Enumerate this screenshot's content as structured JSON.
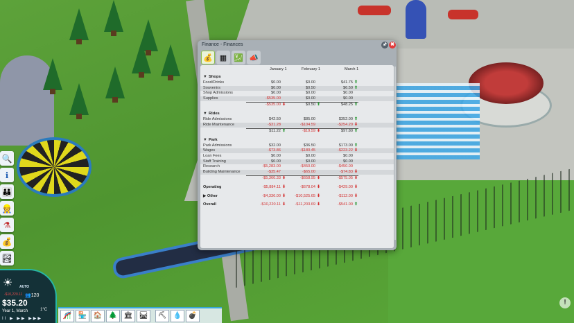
{
  "window": {
    "title": "Finance - Finances",
    "pin_glyph": "🖈",
    "close_glyph": "✖",
    "tabs": [
      {
        "icon": "coins-icon",
        "glyph": "💰",
        "active": true
      },
      {
        "icon": "safe-icon",
        "glyph": "▦",
        "active": false
      },
      {
        "icon": "money-chart-icon",
        "glyph": "💹",
        "active": false
      },
      {
        "icon": "marketing-icon",
        "glyph": "📣",
        "active": false
      }
    ]
  },
  "finance": {
    "months": [
      "January 1",
      "February 1",
      "March 1"
    ],
    "sections": [
      {
        "name": "Shops",
        "rows": [
          {
            "label": "Food/Drinks",
            "values": [
              "$0.00",
              "$0.00",
              "$41.75"
            ],
            "arrows": [
              "",
              "",
              "up"
            ]
          },
          {
            "label": "Souvenirs",
            "values": [
              "$0.00",
              "$0.50",
              "$6.50"
            ],
            "arrows": [
              "",
              "",
              "up"
            ]
          },
          {
            "label": "Shop Admissions",
            "values": [
              "$0.00",
              "$0.00",
              "$0.00"
            ],
            "arrows": [
              "",
              "",
              ""
            ]
          },
          {
            "label": "Supplies",
            "values": [
              "-$535.00",
              "$0.00",
              "$0.00"
            ],
            "arrows": [
              "",
              "",
              ""
            ]
          }
        ],
        "total": {
          "values": [
            "-$535.00",
            "$0.50",
            "$48.25"
          ],
          "arrows": [
            "down",
            "up",
            "up"
          ]
        }
      },
      {
        "name": "Rides",
        "rows": [
          {
            "label": "Ride Admissions",
            "values": [
              "$42.50",
              "$85.00",
              "$352.00"
            ],
            "arrows": [
              "",
              "",
              "up"
            ]
          },
          {
            "label": "Ride Maintenance",
            "values": [
              "-$31.28",
              "-$104.59",
              "-$254.20"
            ],
            "arrows": [
              "",
              "",
              "down"
            ]
          }
        ],
        "total": {
          "values": [
            "$11.22",
            "-$19.59",
            "$97.80"
          ],
          "arrows": [
            "up",
            "down",
            "up"
          ]
        }
      },
      {
        "name": "Park",
        "rows": [
          {
            "label": "Park Admissions",
            "values": [
              "$32.00",
              "$36.50",
              "$173.00"
            ],
            "arrows": [
              "",
              "",
              "up"
            ]
          },
          {
            "label": "Wages",
            "values": [
              "-$73.86",
              "-$180.45",
              "-$223.22"
            ],
            "arrows": [
              "",
              "",
              "down"
            ]
          },
          {
            "label": "Loan Fees",
            "values": [
              "$0.00",
              "$0.00",
              "$0.00"
            ],
            "arrows": [
              "",
              "",
              ""
            ]
          },
          {
            "label": "Staff Training",
            "values": [
              "$0.00",
              "$0.00",
              "$0.00"
            ],
            "arrows": [
              "",
              "",
              ""
            ]
          },
          {
            "label": "Research",
            "values": [
              "-$5,283.00",
              "-$450.00",
              "-$450.00"
            ],
            "arrows": [
              "",
              "",
              ""
            ]
          },
          {
            "label": "Building Maintenance",
            "values": [
              "-$35.47",
              "-$65.00",
              "-$74.83"
            ],
            "arrows": [
              "",
              "",
              "down"
            ]
          }
        ],
        "total": {
          "values": [
            "-$5,360.33",
            "-$658.95",
            "-$575.05"
          ],
          "arrows": [
            "down",
            "down",
            "down"
          ]
        }
      }
    ],
    "operating": {
      "label": "Operating",
      "values": [
        "-$5,884.11",
        "-$678.04",
        "-$429.00"
      ],
      "arrows": [
        "down",
        "down",
        "down"
      ]
    },
    "other": {
      "label": "Other",
      "values": [
        "-$4,336.00",
        "-$10,525.65",
        "-$112.00"
      ],
      "arrows": [
        "down",
        "down",
        "down"
      ]
    },
    "overall": {
      "label": "Overall",
      "values": [
        "-$10,220.11",
        "-$11,203.69",
        "-$541.00"
      ],
      "arrows": [
        "down",
        "down",
        "up"
      ]
    }
  },
  "hud": {
    "speed_label": "AUTO",
    "guest_count": "120",
    "money_negative": "-$10,220.11",
    "money": "$35.20",
    "date": "Year 1, March",
    "temperature": "1°C",
    "playback": "II ▶ ▶▶ ▶▶▶"
  },
  "left_toolbar": [
    {
      "icon": "search-icon",
      "glyph": "🔍"
    },
    {
      "icon": "info-icon",
      "glyph": "ℹ"
    },
    {
      "icon": "guests-icon",
      "glyph": "👪"
    },
    {
      "icon": "staff-icon",
      "glyph": "👷"
    },
    {
      "icon": "research-flask-icon",
      "glyph": "⚗"
    },
    {
      "icon": "finance-coins-icon",
      "glyph": "💰"
    },
    {
      "icon": "park-management-icon",
      "glyph": "🏞"
    }
  ],
  "build_bar": [
    {
      "icon": "rides-icon",
      "glyph": "🎢"
    },
    {
      "icon": "shops-icon",
      "glyph": "🏪"
    },
    {
      "icon": "facilities-icon",
      "glyph": "🏠"
    },
    {
      "icon": "scenery-tree-icon",
      "glyph": "🌲"
    },
    {
      "icon": "buildings-icon",
      "glyph": "🏛"
    },
    {
      "icon": "paths-icon",
      "glyph": "🛤"
    },
    {
      "icon": "terrain-tool-icon",
      "glyph": "⛏"
    },
    {
      "icon": "water-tool-icon",
      "glyph": "💧"
    },
    {
      "icon": "demolish-icon",
      "glyph": "💣"
    }
  ],
  "info_button": "!"
}
